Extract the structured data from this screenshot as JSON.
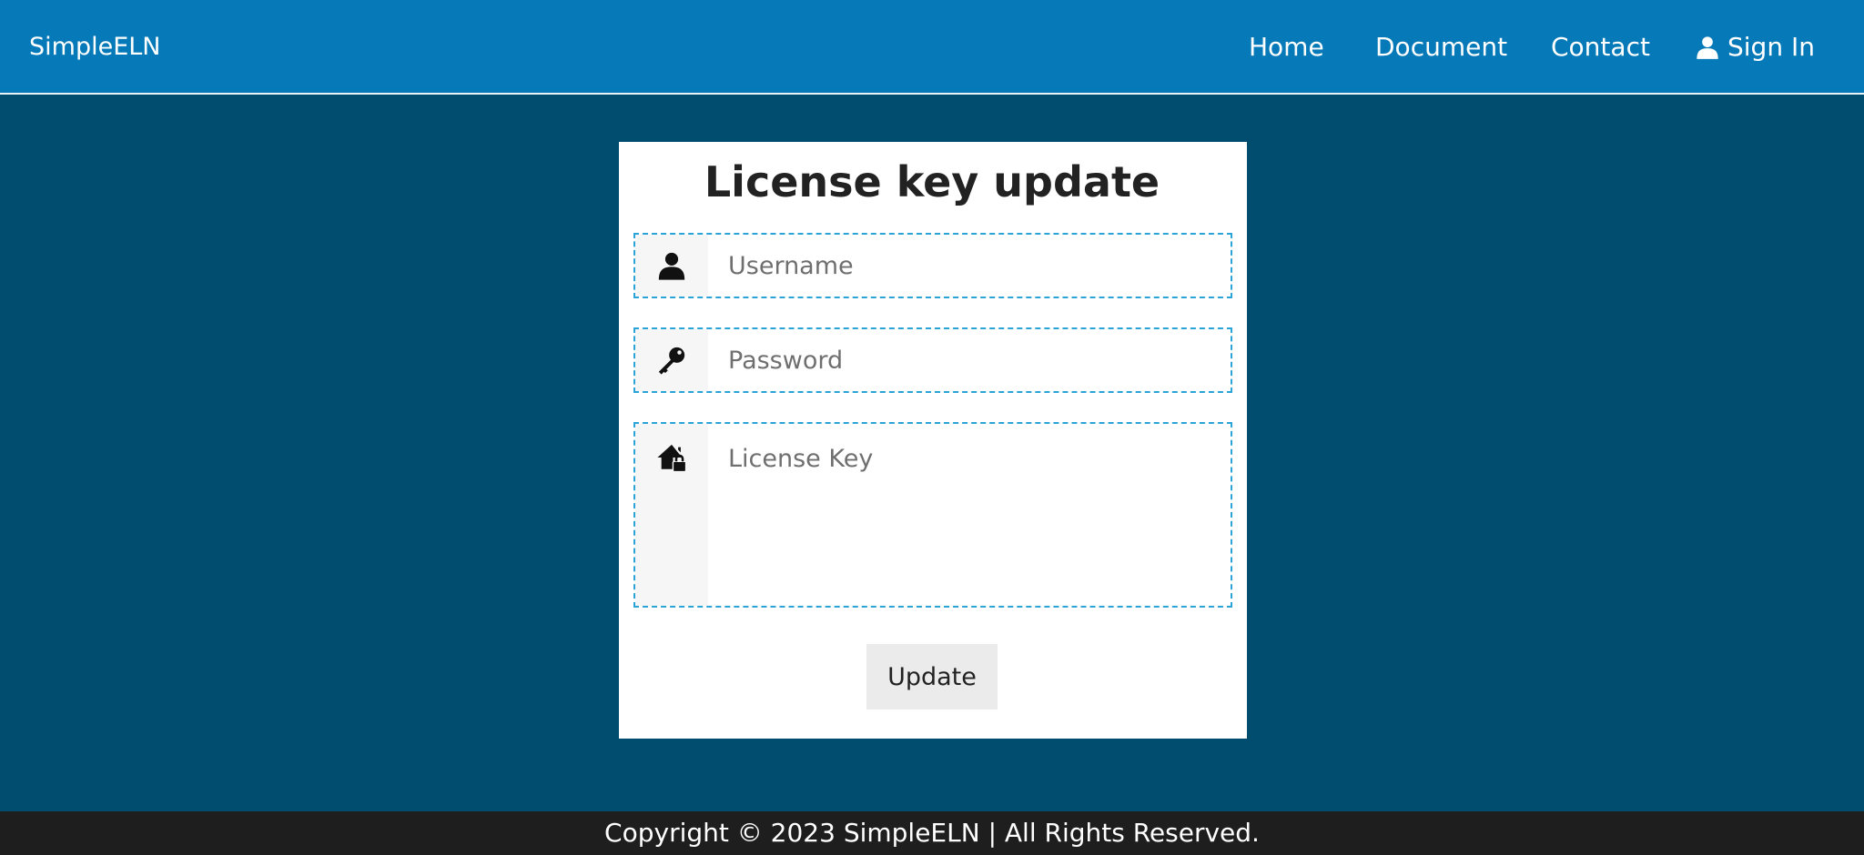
{
  "header": {
    "brand": "SimpleELN",
    "nav": {
      "home": "Home",
      "document": "Document",
      "contact": "Contact",
      "sign_in": "Sign In"
    },
    "sign_in_icon": "user-icon"
  },
  "form": {
    "title": "License key update",
    "username": {
      "icon": "user-icon",
      "placeholder": "Username",
      "value": ""
    },
    "password": {
      "icon": "key-icon",
      "placeholder": "Password",
      "value": ""
    },
    "license_key": {
      "icon": "house-lock-icon",
      "placeholder": "License Key",
      "value": ""
    },
    "submit_label": "Update"
  },
  "footer": {
    "text": "Copyright © 2023 SimpleELN | All Rights Reserved."
  },
  "colors": {
    "header_bg": "#067ab8",
    "page_bg": "#004d70",
    "field_border": "#2ba3d6",
    "footer_bg": "#1e1e1e"
  }
}
